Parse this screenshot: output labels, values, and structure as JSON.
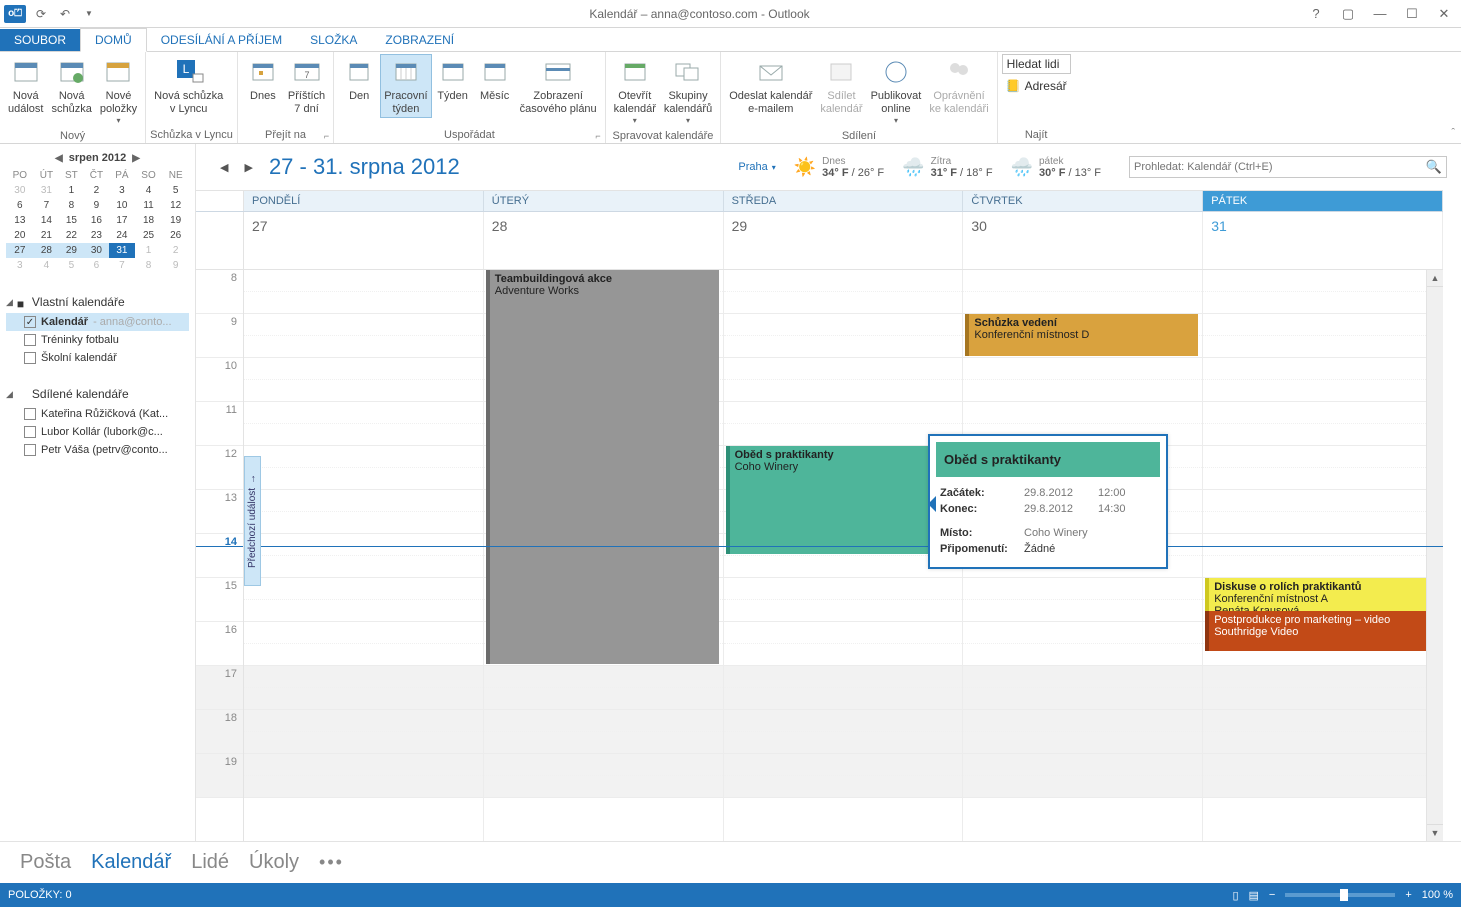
{
  "title": "Kalendář – anna@contoso.com - Outlook",
  "tabs": {
    "file": "SOUBOR",
    "home": "DOMŮ",
    "sendrecv": "ODESÍLÁNÍ A PŘÍJEM",
    "folder": "SLOŽKA",
    "view": "ZOBRAZENÍ"
  },
  "ribbon": {
    "new": {
      "label": "Nový",
      "newappt": "Nová\nudálost",
      "newmeet": "Nová\nschůzka",
      "newitems": "Nové\npoložky"
    },
    "lync": {
      "label": "Schůzka v Lyncu",
      "btn": "Nová schůzka\nv Lyncu"
    },
    "goto": {
      "label": "Přejít na",
      "today": "Dnes",
      "next7": "Příštích\n7 dní"
    },
    "arrange": {
      "label": "Uspořádat",
      "day": "Den",
      "workweek": "Pracovní\ntýden",
      "week": "Týden",
      "month": "Měsíc",
      "schedule": "Zobrazení\nčasového plánu"
    },
    "manage": {
      "label": "Spravovat kalendáře",
      "open": "Otevřít\nkalendář",
      "groups": "Skupiny\nkalendářů"
    },
    "share": {
      "label": "Sdílení",
      "email": "Odeslat kalendář\ne-mailem",
      "sharecal": "Sdílet\nkalendář",
      "publish": "Publikovat\nonline",
      "perms": "Oprávnění\nke kalendáři"
    },
    "find": {
      "label": "Najít",
      "people": "Hledat lidi",
      "addressbook": "Adresář"
    }
  },
  "minical": {
    "month": "srpen 2012",
    "dow": [
      "PO",
      "ÚT",
      "ST",
      "ČT",
      "PÁ",
      "SO",
      "NE"
    ],
    "rows": [
      [
        {
          "d": "30",
          "dim": true
        },
        {
          "d": "31",
          "dim": true
        },
        {
          "d": "1"
        },
        {
          "d": "2"
        },
        {
          "d": "3"
        },
        {
          "d": "4"
        },
        {
          "d": "5"
        }
      ],
      [
        {
          "d": "6"
        },
        {
          "d": "7"
        },
        {
          "d": "8"
        },
        {
          "d": "9"
        },
        {
          "d": "10"
        },
        {
          "d": "11"
        },
        {
          "d": "12"
        }
      ],
      [
        {
          "d": "13"
        },
        {
          "d": "14"
        },
        {
          "d": "15"
        },
        {
          "d": "16"
        },
        {
          "d": "17"
        },
        {
          "d": "18"
        },
        {
          "d": "19"
        }
      ],
      [
        {
          "d": "20"
        },
        {
          "d": "21"
        },
        {
          "d": "22"
        },
        {
          "d": "23"
        },
        {
          "d": "24"
        },
        {
          "d": "25"
        },
        {
          "d": "26"
        }
      ],
      [
        {
          "d": "27",
          "hl": true
        },
        {
          "d": "28",
          "hl": true
        },
        {
          "d": "29",
          "hl": true
        },
        {
          "d": "30",
          "hl": true
        },
        {
          "d": "31",
          "today": true
        },
        {
          "d": "1",
          "dim": true
        },
        {
          "d": "2",
          "dim": true
        }
      ],
      [
        {
          "d": "3",
          "dim": true
        },
        {
          "d": "4",
          "dim": true
        },
        {
          "d": "5",
          "dim": true
        },
        {
          "d": "6",
          "dim": true
        },
        {
          "d": "7",
          "dim": true
        },
        {
          "d": "8",
          "dim": true
        },
        {
          "d": "9",
          "dim": true
        }
      ]
    ]
  },
  "calgroups": {
    "own": {
      "label": "Vlastní kalendáře",
      "items": [
        {
          "name": "Kalendář",
          "suffix": " - anna@conto...",
          "checked": true,
          "sel": true
        },
        {
          "name": "Tréninky fotbalu",
          "checked": false
        },
        {
          "name": "Školní kalendář",
          "checked": false
        }
      ]
    },
    "shared": {
      "label": "Sdílené kalendáře",
      "items": [
        {
          "name": "Kateřina Růžičková (Kat...",
          "checked": false
        },
        {
          "name": "Lubor Kollár (lubork@c...",
          "checked": false
        },
        {
          "name": "Petr Váša (petrv@conto...",
          "checked": false
        }
      ]
    }
  },
  "header": {
    "range": "27 - 31. srpna 2012",
    "city": "Praha",
    "forecast": [
      {
        "label": "Dnes",
        "temp": "34° F / 26° F",
        "icon": "sun"
      },
      {
        "label": "Zítra",
        "temp": "31° F / 18° F",
        "icon": "rain"
      },
      {
        "label": "pátek",
        "temp": "30° F / 13° F",
        "icon": "rain"
      }
    ],
    "search_placeholder": "Prohledat: Kalendář (Ctrl+E)"
  },
  "days": [
    {
      "label": "PONDĚLÍ",
      "date": "27"
    },
    {
      "label": "ÚTERÝ",
      "date": "28"
    },
    {
      "label": "STŘEDA",
      "date": "29"
    },
    {
      "label": "ČTVRTEK",
      "date": "30"
    },
    {
      "label": "PÁTEK",
      "date": "31",
      "fri": true
    }
  ],
  "hours": [
    "8",
    "9",
    "10",
    "11",
    "12",
    "13",
    "14",
    "15",
    "16",
    "17",
    "18",
    "19"
  ],
  "currentHour": "14",
  "prevHandle": "Předchozí událost",
  "events": {
    "tue": {
      "title": "Teambuildingová akce",
      "loc": "Adventure Works"
    },
    "thu9": {
      "title": "Schůzka vedení",
      "loc": "Konferenční místnost D"
    },
    "wed12": {
      "title": "Oběd s praktikanty",
      "loc": "Coho Winery"
    },
    "fri15a": {
      "title": "Diskuse o rolích praktikantů",
      "loc": "Konferenční místnost A",
      "who": "Renáta Krausová"
    },
    "fri15b": {
      "title": "Postprodukce pro marketing – video",
      "loc": "Southridge Video"
    }
  },
  "popup": {
    "title": "Oběd s praktikanty",
    "rows": [
      {
        "k": "Začátek:",
        "v1": "29.8.2012",
        "v2": "12:00"
      },
      {
        "k": "Konec:",
        "v1": "29.8.2012",
        "v2": "14:30"
      }
    ],
    "loc_k": "Místo:",
    "loc_v": "Coho Winery",
    "rem_k": "Připomenutí:",
    "rem_v": "Žádné"
  },
  "bottomnav": {
    "mail": "Pošta",
    "cal": "Kalendář",
    "people": "Lidé",
    "tasks": "Úkoly"
  },
  "status": {
    "items": "POLOŽKY: 0",
    "zoom": "100 %"
  }
}
